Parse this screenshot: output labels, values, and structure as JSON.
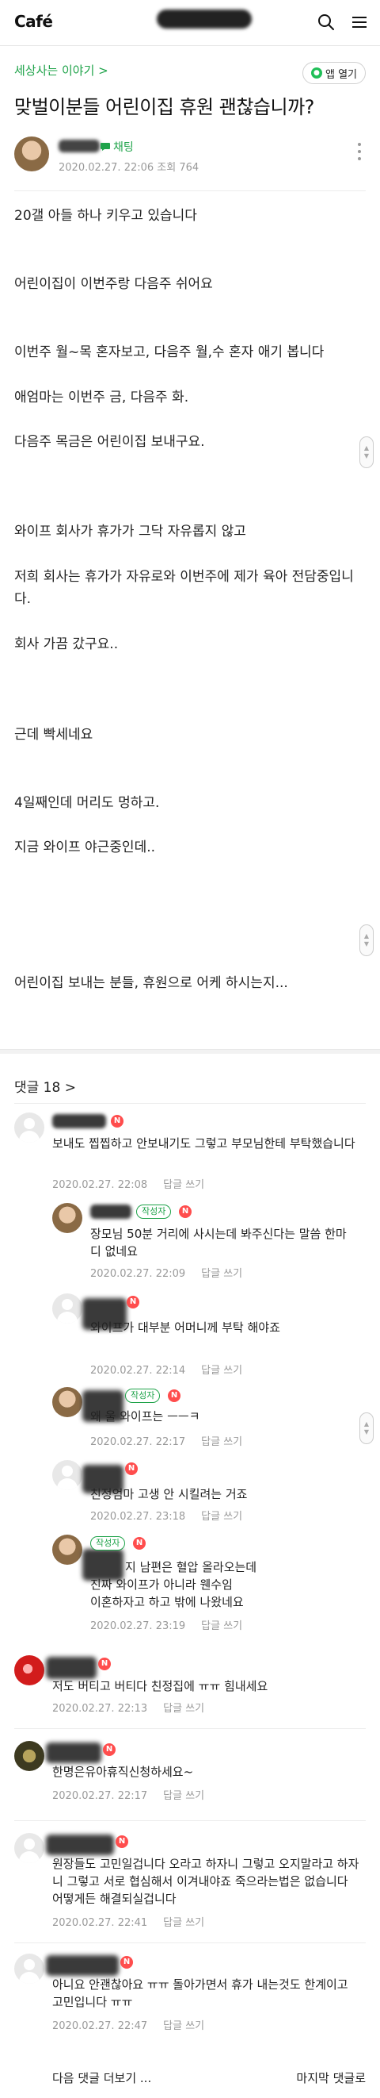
{
  "header": {
    "logo": "Café",
    "search_icon": "search-icon",
    "menu_icon": "menu-icon"
  },
  "post": {
    "board": "세상사는 이야기 >",
    "app_open": "앱 열기",
    "title": "맞벌이분들 어린이집 휴원 괜찮습니까?",
    "chat": "채팅",
    "meta": "2020.02.27. 22:06 조회 764",
    "lines": [
      "20갤 아들 하나 키우고 있습니다",
      "어린이집이 이번주랑 다음주 쉬어요",
      "이번주 월~목 혼자보고, 다음주 월,수 혼자 애기 봅니다",
      "애엄마는 이번주 금, 다음주 화.",
      "다음주 목금은 어린이집 보내구요.",
      "와이프 회사가 휴가가 그닥 자유롭지 않고",
      "저희 회사는 휴가가 자유로와 이번주에 제가 육아 전담중입니다.",
      "회사 가끔 갔구요..",
      "근데 빡세네요",
      "4일째인데 머리도 멍하고.",
      "지금 와이프 야근중인데..",
      "어린이집 보내는 분들, 휴원으로 어케 하시는지..."
    ]
  },
  "comments_header": "댓글 18 >",
  "badges": {
    "author": "작성자",
    "new": "N"
  },
  "reply_label": "답글 쓰기",
  "comments": [
    {
      "text": "보내도 찝찝하고 안보내기도 그렇고 부모님한테 부탁했습니다",
      "date": "2020.02.27. 22:08"
    },
    {
      "text": "장모님 50분 거리에 사시는데 봐주신다는 말씀 한마디 없네요",
      "date": "2020.02.27. 22:09"
    },
    {
      "text": "와이프가 대부분 어머니께 부탁 해야죠",
      "date": "2020.02.27. 22:14"
    },
    {
      "text": "왜 울 와이프는 ㅡㅡㅋ",
      "date": "2020.02.27. 22:17"
    },
    {
      "text": "친정엄마 고생 안 시킬려는 거죠",
      "date": "2020.02.27. 23:18"
    },
    {
      "text": "지 남편은 혈압 올라오는데\n진짜 와이프가 아니라 웬수임\n이혼하자고 하고 밖에 나왔네요",
      "date": "2020.02.27. 23:19"
    },
    {
      "text": "저도 버티고 버티다 친정집에 ㅠㅠ 힘내세요",
      "date": "2020.02.27. 22:13"
    },
    {
      "text": "한명은유아휴직신청하세요~",
      "date": "2020.02.27. 22:17"
    },
    {
      "text": "원장들도 고민일겁니다 오라고 하자니 그렇고 오지말라고 하자니 그렇고 서로 협심해서 이겨내야죠 죽으라는법은 없습니다 어떻게든 해결되실겁니다",
      "date": "2020.02.27. 22:41"
    },
    {
      "text": "아니요 안괜찮아요 ㅠㅠ 돌아가면서 휴가 내는것도 한계이고 고민입니다 ㅠㅠ",
      "date": "2020.02.27. 22:47"
    }
  ],
  "footer": {
    "more_comments": "다음 댓글 더보기 ...",
    "last_comment": "마지막 댓글로"
  }
}
